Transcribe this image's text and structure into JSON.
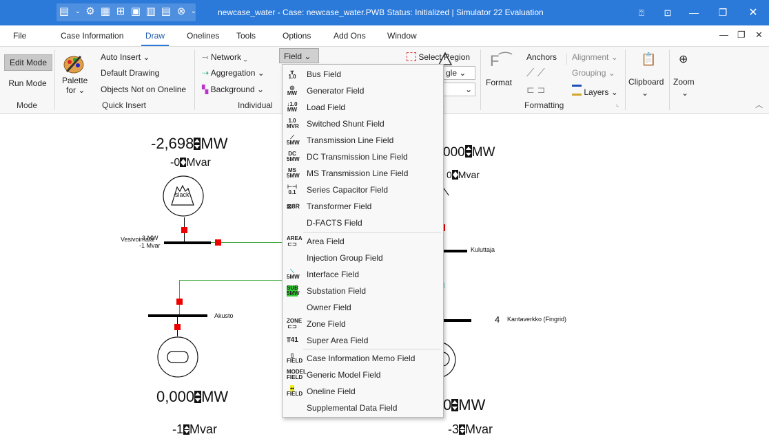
{
  "window": {
    "title": "newcase_water - Case: newcase_water.PWB  Status: Initialized | Simulator 22 Evaluation",
    "accent": "#2b79d8"
  },
  "menu": {
    "tabs": [
      "File",
      "Case Information",
      "Draw",
      "Onelines",
      "Tools",
      "Options",
      "Add Ons",
      "Window"
    ],
    "active": "Draw"
  },
  "ribbon": {
    "mode": {
      "edit": "Edit Mode",
      "run": "Run Mode",
      "label": "Mode"
    },
    "quick_insert": {
      "palette": "Palette",
      "palette_for": "for",
      "auto_insert": "Auto Insert",
      "default_drawing": "Default Drawing",
      "objects_not_on_oneline": "Objects Not on Oneline",
      "label": "Quick Insert"
    },
    "individual": {
      "network": "Network",
      "aggregation": "Aggregation",
      "background": "Background",
      "field": "Field",
      "label": "Individual"
    },
    "select": {
      "select_region": "Select Region",
      "combo_text": "gle"
    },
    "formatting": {
      "format": "Format",
      "anchors": "Anchors",
      "alignment": "Alignment",
      "grouping": "Grouping",
      "layers": "Layers",
      "label": "Formatting"
    },
    "clipboard": "Clipboard",
    "zoom": "Zoom"
  },
  "dropdown": {
    "items": [
      {
        "icon": "bus-field-icon",
        "glyph": "1.0pu",
        "label": "Bus Field"
      },
      {
        "icon": "generator-field-icon",
        "glyph": "1.0 MW",
        "label": "Generator Field"
      },
      {
        "icon": "load-field-icon",
        "glyph": "1.0 MW",
        "label": "Load Field"
      },
      {
        "icon": "switched-shunt-field-icon",
        "glyph": "1.0 MVR",
        "label": "Switched Shunt Field"
      },
      {
        "icon": "transmission-line-field-icon",
        "glyph": "5MW",
        "label": "Transmission Line Field"
      },
      {
        "icon": "dc-line-field-icon",
        "glyph": "DC 5MW",
        "label": "DC Transmission Line Field"
      },
      {
        "icon": "ms-line-field-icon",
        "glyph": "MS 5MW",
        "label": "MS Transmission Line Field"
      },
      {
        "icon": "series-capacitor-field-icon",
        "glyph": "0.1pu",
        "label": "Series Capacitor Field"
      },
      {
        "icon": "transformer-field-icon",
        "glyph": "8R",
        "label": "Transformer Field"
      },
      {
        "icon": "",
        "glyph": "",
        "label": "D-FACTS Field"
      },
      {
        "icon": "area-field-icon",
        "glyph": "AREA",
        "label": "Area Field"
      },
      {
        "icon": "",
        "glyph": "",
        "label": "Injection Group Field"
      },
      {
        "icon": "interface-field-icon",
        "glyph": "5MW",
        "label": "Interface Field"
      },
      {
        "icon": "substation-field-icon",
        "glyph": "SUB 5MW",
        "label": "Substation Field"
      },
      {
        "icon": "",
        "glyph": "",
        "label": "Owner Field"
      },
      {
        "icon": "zone-field-icon",
        "glyph": "ZONE",
        "label": "Zone Field"
      },
      {
        "icon": "super-area-field-icon",
        "glyph": "41",
        "label": "Super Area Field"
      },
      {
        "icon": "case-info-memo-field-icon",
        "glyph": "FIELD",
        "label": "Case Information Memo Field"
      },
      {
        "icon": "generic-model-field-icon",
        "glyph": "MODEL FIELD",
        "label": "Generic Model Field"
      },
      {
        "icon": "oneline-field-icon",
        "glyph": "FIELD",
        "label": "Oneline Field"
      },
      {
        "icon": "",
        "glyph": "",
        "label": "Supplemental Data Field"
      }
    ]
  },
  "oneline": {
    "gen1_mw": "-2,698",
    "gen1_mvar": "-0",
    "gen1_label": "slack",
    "bus_vesi": "Vesivoimala",
    "bus_vesi_mw": "3 MW",
    "bus_vesi_mvar": "-1 Mvar",
    "bus_akusto": "Akusto",
    "gen2_mw": "0,000",
    "gen2_mvar": "-1",
    "right_top_mw": "000",
    "right_top_mvar": "0",
    "bus_kuluttaja": "Kuluttaja",
    "bus_kanta_num": "4",
    "bus_kanta": "Kantaverkko (Fingrid)",
    "right_bot_mw": "0",
    "right_bot_mvar": "-3",
    "unit_mw": "MW",
    "unit_mvar": "Mvar"
  }
}
